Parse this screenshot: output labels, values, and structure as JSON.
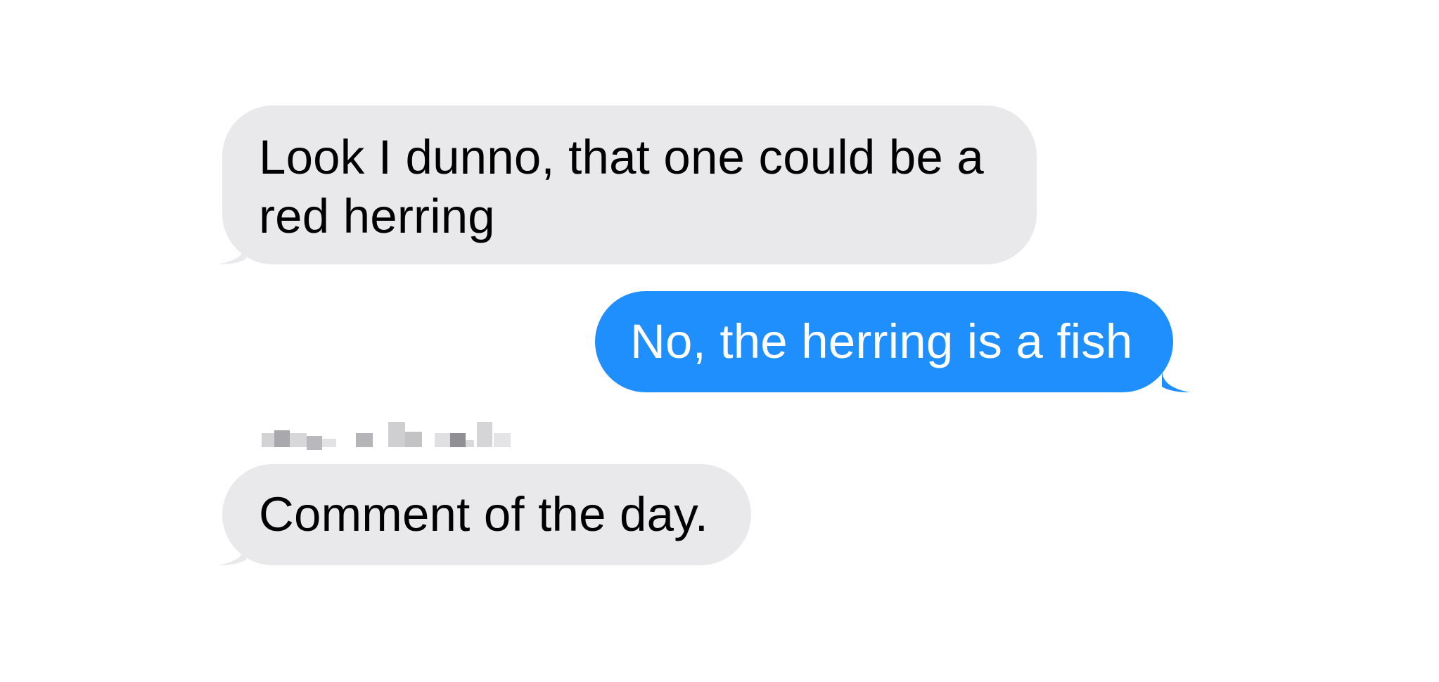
{
  "conversation": {
    "messages": [
      {
        "direction": "received",
        "text": "Look I dunno, that one could be a red herring"
      },
      {
        "direction": "sent",
        "text": "No, the herring is a fish"
      },
      {
        "direction": "received",
        "sender_redacted": true,
        "text": "Comment of the day."
      }
    ]
  },
  "colors": {
    "received_bubble": "#e9e9eb",
    "received_text": "#000000",
    "sent_bubble": "#1f8ffe",
    "sent_text": "#ffffff",
    "background": "#ffffff",
    "redacted_name": "#c9c9cc"
  }
}
